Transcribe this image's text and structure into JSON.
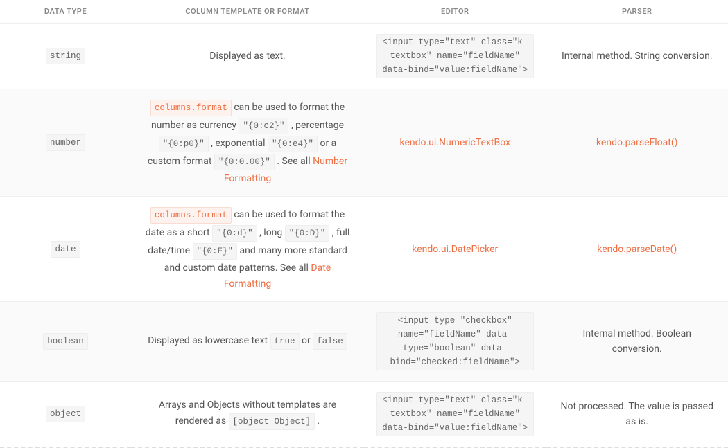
{
  "headers": {
    "datatype": "DATA TYPE",
    "template": "COLUMN TEMPLATE OR FORMAT",
    "editor": "EDITOR",
    "parser": "PARSER"
  },
  "rows": {
    "string": {
      "datatype": "string",
      "template_text": "Displayed as text.",
      "editor_code": "<input type=\"text\" class=\"k-textbox\" name=\"fieldName\" data-bind=\"value:fieldName\">",
      "parser_text": "Internal method. String conversion."
    },
    "number": {
      "datatype": "number",
      "template": {
        "link1": "columns.format",
        "t1": " can be used to format the number as currency ",
        "c1": "\"{0:c2}\"",
        "t2": " , percentage ",
        "c2": "\"{0:p0}\"",
        "t3": " , exponential ",
        "c3": "\"{0:e4}\"",
        "t4": " or a custom format ",
        "c4": "\"{0:0.00}\"",
        "t5": " . See all ",
        "link2": "Number Formatting"
      },
      "editor_link": "kendo.ui.NumericTextBox",
      "parser_link": "kendo.parseFloat()"
    },
    "date": {
      "datatype": "date",
      "template": {
        "link1": "columns.format",
        "t1": " can be used to format the date as a short ",
        "c1": "\"{0:d}\"",
        "t2": " , long ",
        "c2": "\"{0:D}\"",
        "t3": " , full date/time ",
        "c3": "\"{0:F}\"",
        "t4": " and many more standard and custom date patterns. See all ",
        "link2": "Date Formatting"
      },
      "editor_link": "kendo.ui.DatePicker",
      "parser_link": "kendo.parseDate()"
    },
    "boolean": {
      "datatype": "boolean",
      "template": {
        "t1": "Displayed as lowercase text ",
        "c1": "true",
        "t2": " or ",
        "c2": "false"
      },
      "editor_code": "<input type=\"checkbox\" name=\"fieldName\" data-type=\"boolean\" data-bind=\"checked:fieldName\">",
      "parser_text": "Internal method. Boolean conversion."
    },
    "object": {
      "datatype": "object",
      "template": {
        "t1": "Arrays and Objects without templates are rendered as ",
        "c1": "[object Object]",
        "t2": " ."
      },
      "editor_code": "<input type=\"text\" class=\"k-textbox\" name=\"fieldName\" data-bind=\"value:fieldName\">",
      "parser_text": "Not processed. The value is passed as is."
    }
  }
}
